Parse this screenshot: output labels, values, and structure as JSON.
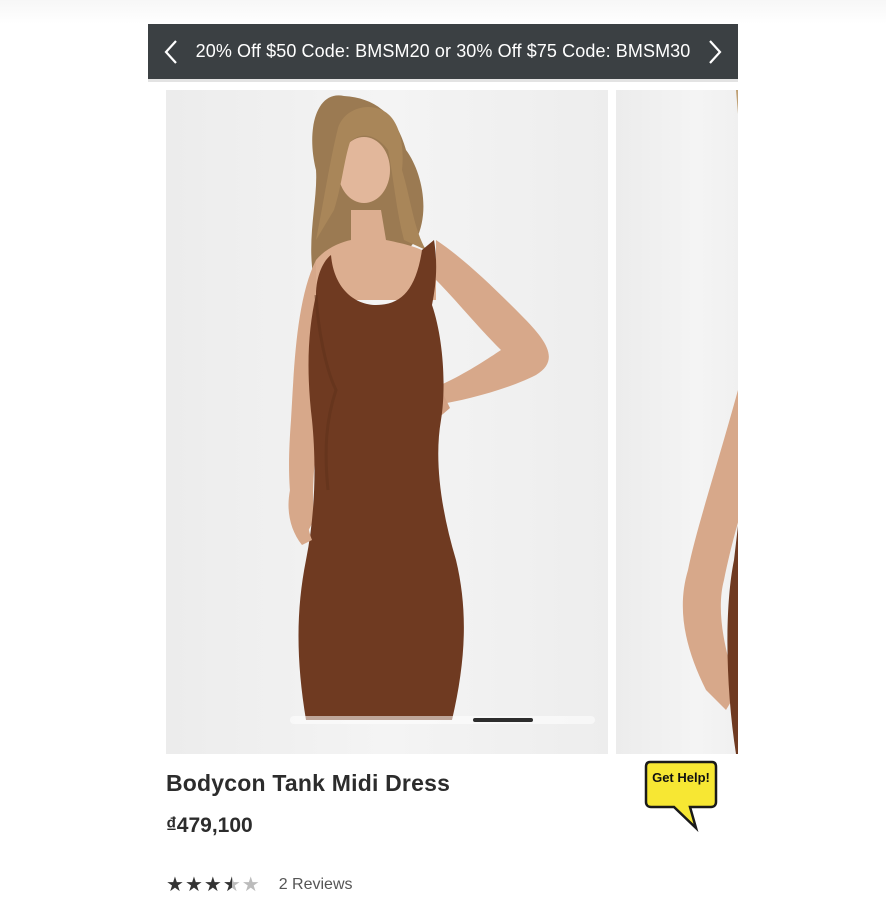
{
  "promo": {
    "text": "20% Off $50 Code: BMSM20 or 30% Off $75 Code: BMSM30",
    "prev_icon": "chevron-left-icon",
    "next_icon": "chevron-right-icon"
  },
  "gallery": {
    "current_index": 1,
    "scroll_position": 0.7
  },
  "product": {
    "title": "Bodycon Tank Midi Dress",
    "price": "₫479,100",
    "rating": 3.5,
    "rating_max": 5,
    "reviews_label": "2 Reviews"
  },
  "help": {
    "label": "Get Help!",
    "color": "#f7e733"
  },
  "colors": {
    "promo_bg": "#3b4043",
    "dress": "#6f3a21",
    "text": "#2c2c2c"
  }
}
